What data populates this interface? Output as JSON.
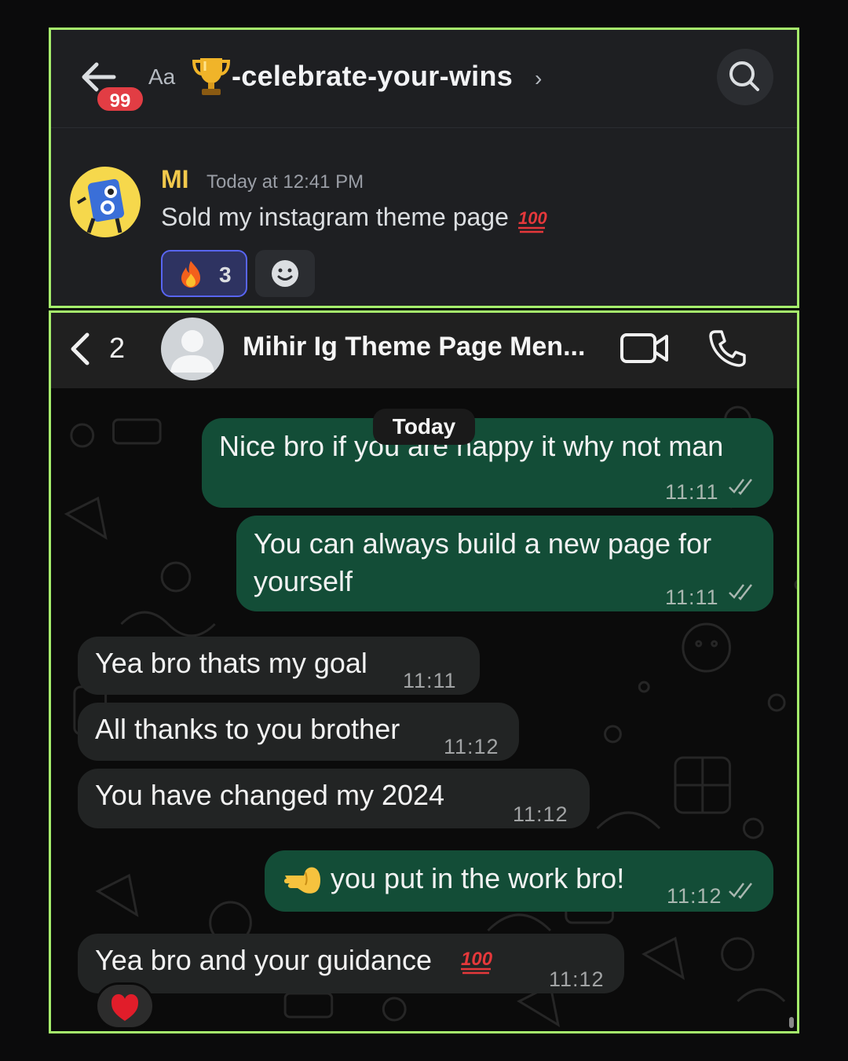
{
  "discord": {
    "header": {
      "unread_badge": "99",
      "text_size_label": "Aa",
      "channel_name": "-celebrate-your-wins",
      "channel_chevron": "›"
    },
    "message": {
      "author": "MI",
      "timestamp": "Today at 12:41 PM",
      "text": "Sold my instagram theme page",
      "emoji": "hundred-points",
      "reactions": [
        {
          "emoji": "fire",
          "count": "3"
        }
      ]
    },
    "icons": [
      "back-arrow-icon",
      "trophy-icon",
      "search-icon",
      "add-reaction-icon"
    ]
  },
  "whatsapp": {
    "header": {
      "back_count": "2",
      "contact_name": "Mihir Ig Theme Page Men..."
    },
    "date_chip": "Today",
    "messages": [
      {
        "direction": "out",
        "text": "Nice bro if you are happy it why not man",
        "time": "11:11",
        "status": "read"
      },
      {
        "direction": "out",
        "text": "You can always build a new page for yourself",
        "time": "11:11",
        "status": "read"
      },
      {
        "direction": "in",
        "text": "Yea bro thats my goal",
        "time": "11:11"
      },
      {
        "direction": "in",
        "text": "All thanks to you brother",
        "time": "11:12"
      },
      {
        "direction": "in",
        "text": "You have changed my 2024",
        "time": "11:12"
      },
      {
        "direction": "out",
        "text": "you put in the work bro!",
        "emoji": "pointing-left",
        "time": "11:12",
        "status": "read"
      },
      {
        "direction": "in",
        "text": "Yea bro and your guidance",
        "emoji": "hundred-points",
        "time": "11:12",
        "reaction": "red-heart"
      }
    ]
  },
  "colors": {
    "frame_border": "#a6f06c",
    "discord_bg": "#1e1f22",
    "discord_author": "#f2c94c",
    "discord_badge": "#e23d44",
    "wa_outgoing": "#134d37",
    "wa_incoming": "#222424"
  }
}
